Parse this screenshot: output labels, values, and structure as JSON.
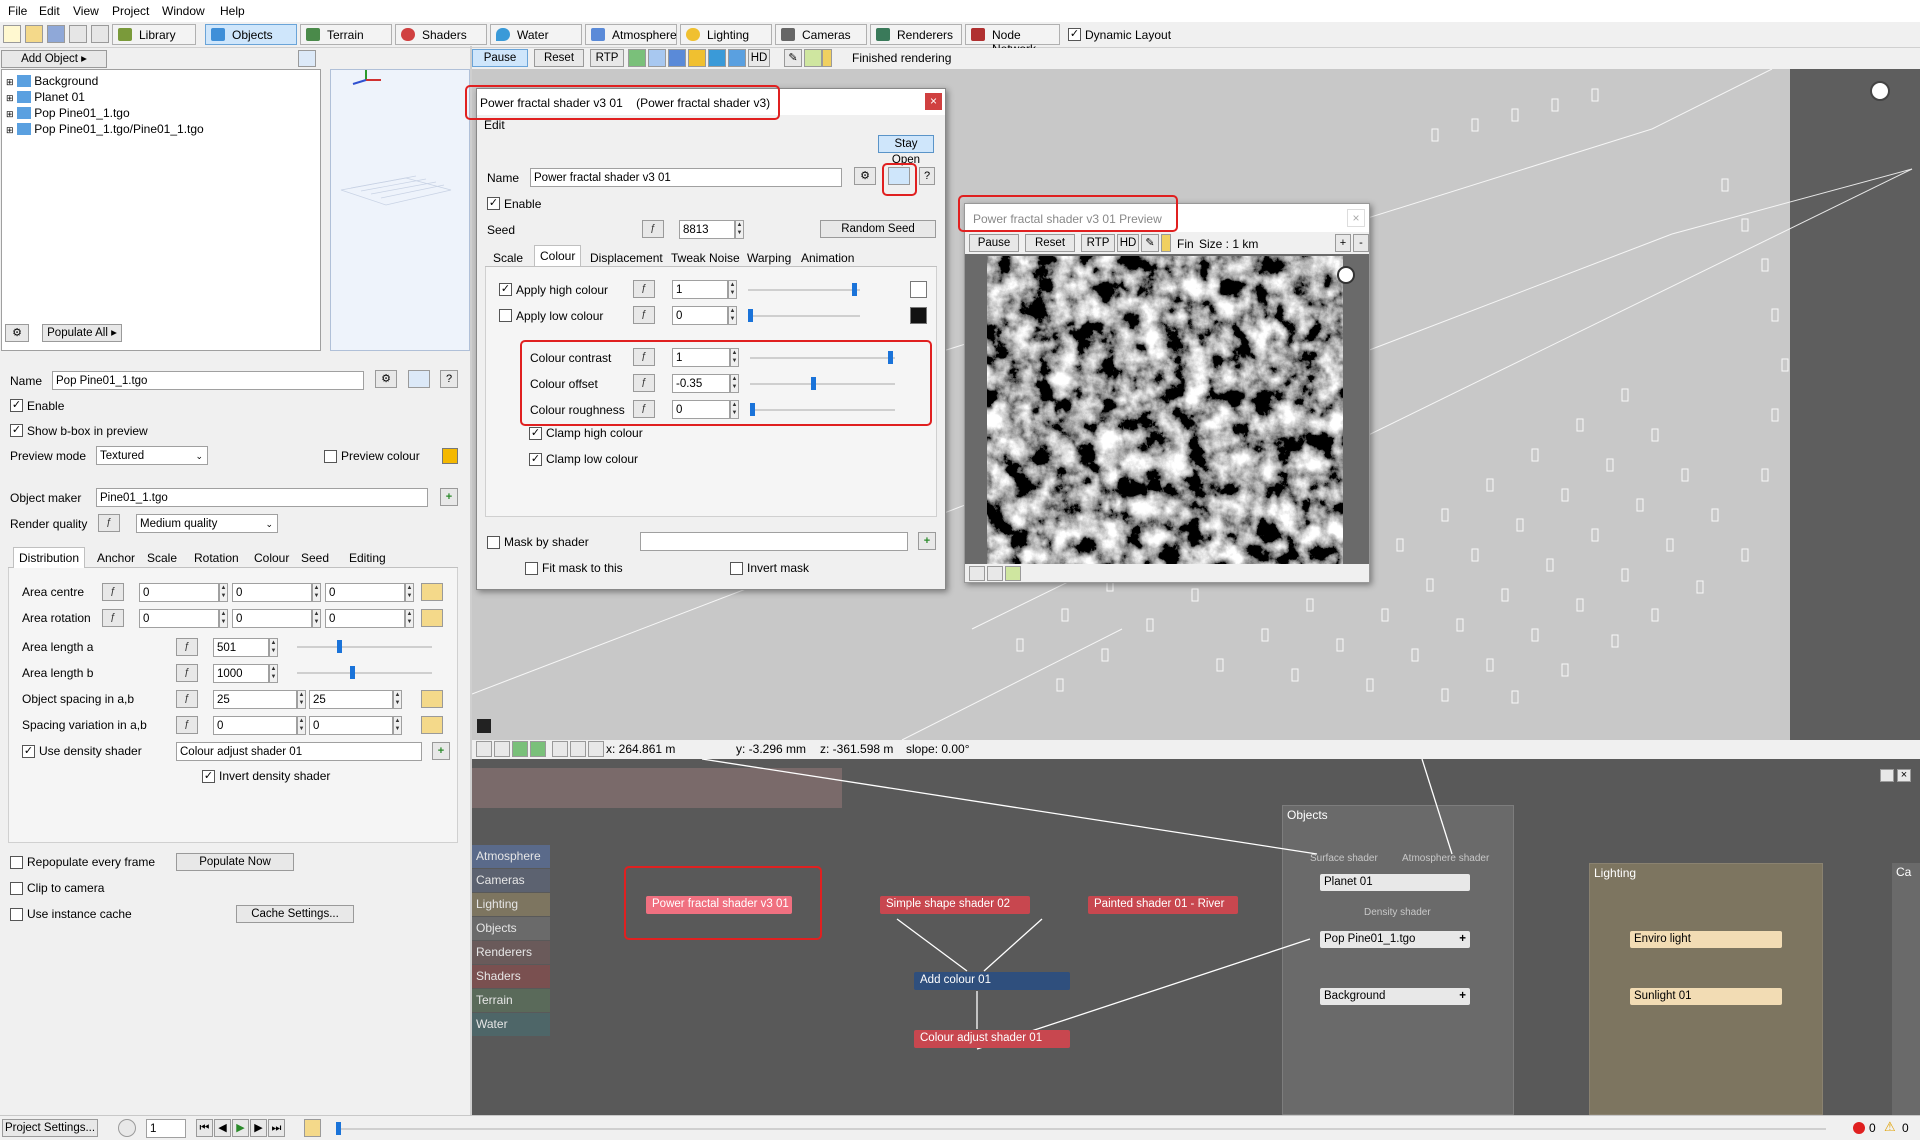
{
  "menubar": {
    "items": [
      "File",
      "Edit",
      "View",
      "Project",
      "Window",
      "Help"
    ]
  },
  "tabs": [
    {
      "label": "Library"
    },
    {
      "label": "Objects"
    },
    {
      "label": "Terrain"
    },
    {
      "label": "Shaders"
    },
    {
      "label": "Water"
    },
    {
      "label": "Atmosphere"
    },
    {
      "label": "Lighting"
    },
    {
      "label": "Cameras"
    },
    {
      "label": "Renderers"
    },
    {
      "label": "Node Network"
    }
  ],
  "dynamic_layout": "Dynamic Layout",
  "left": {
    "add_object": "Add Object",
    "tree": [
      "Background",
      "Planet 01",
      "Pop Pine01_1.tgo",
      "Pop Pine01_1.tgo/Pine01_1.tgo"
    ],
    "populate_all": "Populate All",
    "name_label": "Name",
    "name_value": "Pop Pine01_1.tgo",
    "enable": "Enable",
    "show_bbox": "Show b-box in preview",
    "preview_mode_label": "Preview mode",
    "preview_mode": "Textured",
    "preview_colour": "Preview colour",
    "object_maker_label": "Object maker",
    "object_maker": "Pine01_1.tgo",
    "render_quality_label": "Render quality",
    "render_quality": "Medium quality",
    "subtabs": [
      "Distribution",
      "Anchor",
      "Scale",
      "Rotation",
      "Colour",
      "Seed",
      "Editing"
    ],
    "area_centre": "Area centre",
    "area_rotation": "Area rotation",
    "area_length_a": "Area length a",
    "area_length_a_val": "501",
    "area_length_b": "Area length b",
    "area_length_b_val": "1000",
    "object_spacing": "Object spacing in a,b",
    "spacing_a": "25",
    "spacing_b": "25",
    "spacing_variation": "Spacing variation in a,b",
    "use_density": "Use density shader",
    "density_shader": "Colour adjust shader 01",
    "invert_density": "Invert density shader",
    "repopulate": "Repopulate every frame",
    "populate_now": "Populate Now",
    "clip_camera": "Clip to camera",
    "instance_cache": "Use instance cache",
    "cache_settings": "Cache Settings...",
    "zero": "0"
  },
  "render_toolbar": {
    "pause": "Pause",
    "reset": "Reset",
    "rtp": "RTP",
    "hd": "HD",
    "status": "Finished rendering"
  },
  "dialog": {
    "title": "Power fractal shader v3 01    (Power fractal shader v3)",
    "edit": "Edit",
    "stay_open": "Stay Open",
    "name_label": "Name",
    "name_value": "Power fractal shader v3 01",
    "enable": "Enable",
    "seed_label": "Seed",
    "seed": "8813",
    "random_seed": "Random Seed",
    "tabs": [
      "Scale",
      "Colour",
      "Displacement",
      "Tweak Noise",
      "Warping",
      "Animation"
    ],
    "apply_high": "Apply high colour",
    "apply_high_val": "1",
    "apply_low": "Apply low colour",
    "apply_low_val": "0",
    "contrast": "Colour contrast",
    "contrast_val": "1",
    "offset": "Colour offset",
    "offset_val": "-0.35",
    "roughness": "Colour roughness",
    "roughness_val": "0",
    "clamp_high": "Clamp high colour",
    "clamp_low": "Clamp low colour",
    "mask": "Mask by shader",
    "fit_mask": "Fit mask to this",
    "invert_mask": "Invert mask"
  },
  "preview": {
    "title": "Power fractal shader v3 01 Preview",
    "pause": "Pause",
    "reset": "Reset",
    "rtp": "RTP",
    "hd": "HD",
    "fin": "Fin",
    "size": "Size : 1 km"
  },
  "statusbar": {
    "x": "x: 264.861 m",
    "y": "y: -3.296 mm",
    "z": "z: -361.598 m",
    "slope": "slope: 0.00°"
  },
  "node_network": {
    "categories": [
      {
        "name": "Atmosphere",
        "color": "#5a6a8a"
      },
      {
        "name": "Cameras",
        "color": "#5c6270"
      },
      {
        "name": "Lighting",
        "color": "#7d7560"
      },
      {
        "name": "Objects",
        "color": "#6a6a6a"
      },
      {
        "name": "Renderers",
        "color": "#6a5a5a"
      },
      {
        "name": "Shaders",
        "color": "#7a5050"
      },
      {
        "name": "Terrain",
        "color": "#5a6a5a"
      },
      {
        "name": "Water",
        "color": "#4e6668"
      }
    ],
    "nodes": {
      "power": "Power fractal shader v3 01",
      "simple": "Simple shape shader 02",
      "painted": "Painted shader 01 - River",
      "add": "Add colour 01",
      "adjust": "Colour adjust shader 01"
    },
    "objects_group": "Objects",
    "surface_shader": "Surface shader",
    "atmosphere_shader": "Atmosphere shader",
    "density_shader": "Density shader",
    "planet": "Planet 01",
    "pop": "Pop Pine01_1.tgo",
    "background": "Background",
    "lighting_group": "Lighting",
    "enviro": "Enviro light",
    "sunlight": "Sunlight 01",
    "cameras_group": "Ca"
  },
  "bottom": {
    "project_settings": "Project Settings...",
    "frame": "1",
    "errors": "0",
    "warnings": "0"
  }
}
